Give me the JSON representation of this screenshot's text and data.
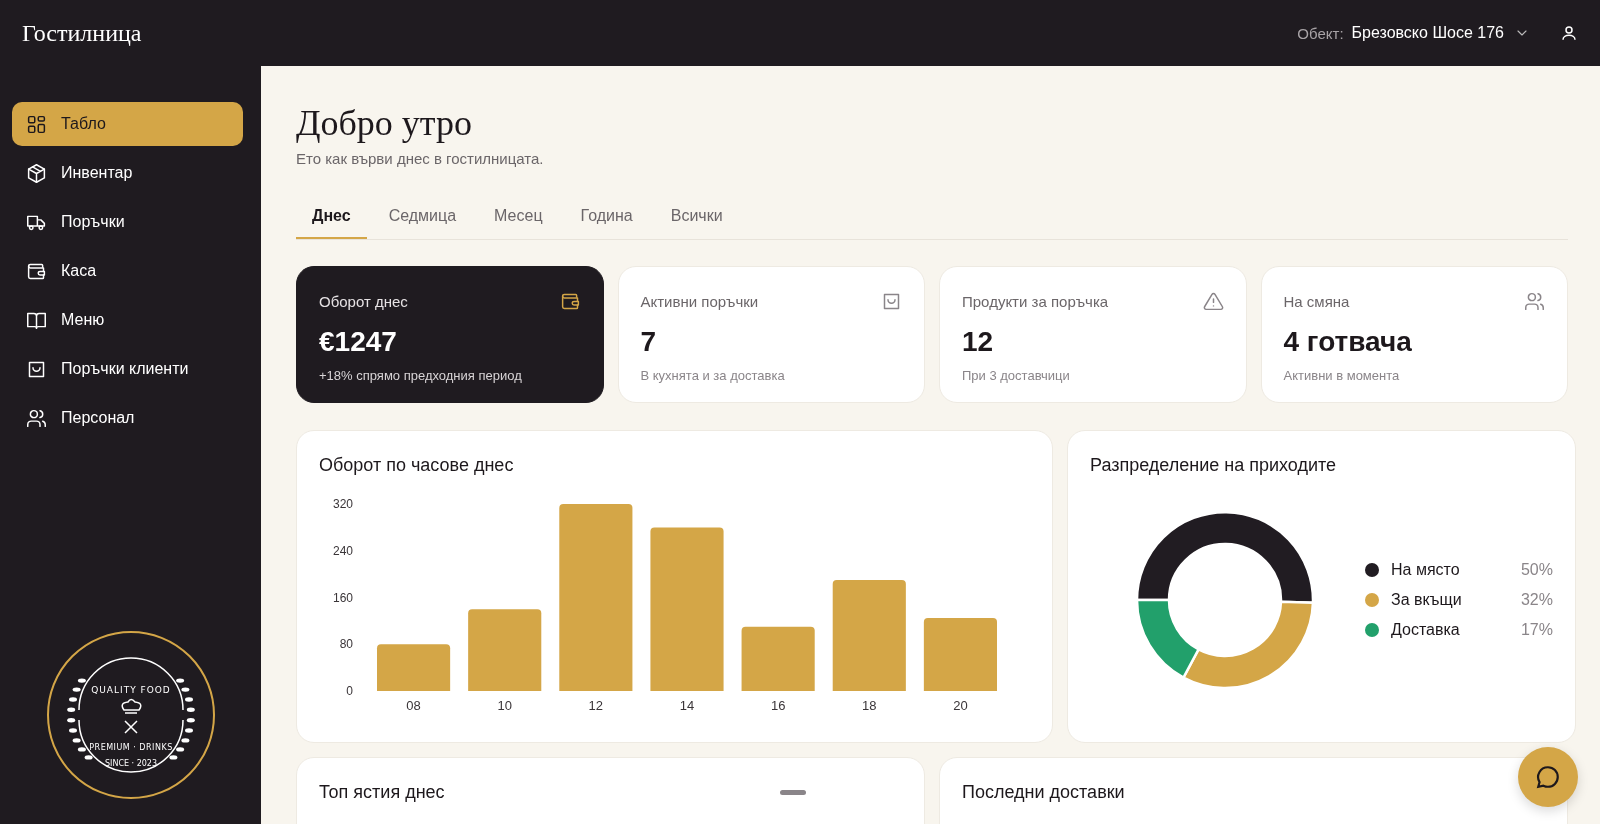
{
  "header": {
    "brand": "Гостилница",
    "location_label": "Обект:",
    "location_value": "Брезовско Шосе 176"
  },
  "sidebar": {
    "items": [
      {
        "label": "Табло",
        "selected": true
      },
      {
        "label": "Инвентар",
        "selected": false
      },
      {
        "label": "Поръчки",
        "selected": false
      },
      {
        "label": "Каса",
        "selected": false
      },
      {
        "label": "Меню",
        "selected": false
      },
      {
        "label": "Поръчки клиенти",
        "selected": false
      },
      {
        "label": "Персонал",
        "selected": false
      }
    ],
    "logo": {
      "top": "QUALITY FOOD",
      "bottom": "PREMIUM · DRINKS",
      "since": "SINCE · 2023"
    }
  },
  "greeting": {
    "title": "Добро утро",
    "subtitle": "Ето как върви днес в гостилницата."
  },
  "tabs": [
    {
      "label": "Днес",
      "selected": true
    },
    {
      "label": "Седмица",
      "selected": false
    },
    {
      "label": "Месец",
      "selected": false
    },
    {
      "label": "Година",
      "selected": false
    },
    {
      "label": "Всички",
      "selected": false
    }
  ],
  "kpis": [
    {
      "title": "Оборот днес",
      "value": "€1247",
      "note": "+18% спрямо предходния период",
      "highlighted": true
    },
    {
      "title": "Активни поръчки",
      "value": "7",
      "note": "В кухнята и за доставка",
      "highlighted": false
    },
    {
      "title": "Продукти за поръчка",
      "value": "12",
      "note": "При 3 доставчици",
      "highlighted": false
    },
    {
      "title": "На смяна",
      "value": "4 готвача",
      "note": "Активни в момента",
      "highlighted": false
    }
  ],
  "hourly": {
    "chart_data": {
      "type": "bar",
      "title": "Оборот по часове днес",
      "categories": [
        "08",
        "10",
        "12",
        "14",
        "16",
        "18",
        "20"
      ],
      "values": [
        80,
        140,
        320,
        280,
        110,
        190,
        125
      ],
      "ylim": [
        0,
        320
      ],
      "yticks": [
        0,
        80,
        160,
        240,
        320
      ]
    }
  },
  "revenue_split": {
    "chart_data": {
      "type": "donut",
      "title": "Разпределение на приходите",
      "categories": [
        "На място",
        "За вкъщи",
        "Доставка"
      ],
      "values": [
        50,
        32,
        17
      ]
    },
    "legend": [
      {
        "value": "50%",
        "color": "#211c22"
      },
      {
        "value": "32%",
        "color": "#d4a647"
      },
      {
        "value": "17%",
        "color": "#22a06b"
      }
    ]
  },
  "bottom_cards": [
    {
      "title": "Топ ястия днес"
    },
    {
      "title": "Последни доставки"
    }
  ]
}
